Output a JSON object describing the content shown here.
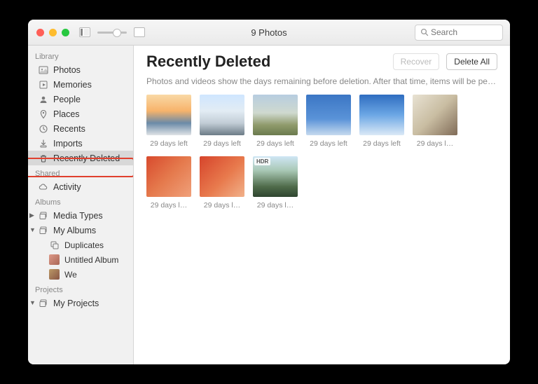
{
  "window_title": "9 Photos",
  "search_placeholder": "Search",
  "sidebar": {
    "sections": [
      {
        "label": "Library",
        "items": [
          {
            "id": "photos",
            "label": "Photos"
          },
          {
            "id": "memories",
            "label": "Memories"
          },
          {
            "id": "people",
            "label": "People"
          },
          {
            "id": "places",
            "label": "Places"
          },
          {
            "id": "recents",
            "label": "Recents"
          },
          {
            "id": "imports",
            "label": "Imports"
          },
          {
            "id": "recently-deleted",
            "label": "Recently Deleted",
            "selected": true
          }
        ]
      },
      {
        "label": "Shared",
        "items": [
          {
            "id": "activity",
            "label": "Activity"
          }
        ]
      },
      {
        "label": "Albums",
        "items": [
          {
            "id": "media-types",
            "label": "Media Types",
            "disclosure": "closed"
          },
          {
            "id": "my-albums",
            "label": "My Albums",
            "disclosure": "open",
            "children": [
              {
                "id": "duplicates",
                "label": "Duplicates"
              },
              {
                "id": "untitled",
                "label": "Untitled Album"
              },
              {
                "id": "we",
                "label": "We"
              }
            ]
          }
        ]
      },
      {
        "label": "Projects",
        "items": [
          {
            "id": "my-projects",
            "label": "My Projects",
            "disclosure": "open"
          }
        ]
      }
    ]
  },
  "header": {
    "title": "Recently Deleted",
    "recover_label": "Recover",
    "delete_all_label": "Delete All",
    "description": "Photos and videos show the days remaining before deletion. After that time, items will be permanently deleted. This may…"
  },
  "hdr_label": "HDR",
  "photos": [
    {
      "caption": "29 days left",
      "thumb": "t0"
    },
    {
      "caption": "29 days left",
      "thumb": "t1"
    },
    {
      "caption": "29 days left",
      "thumb": "t2"
    },
    {
      "caption": "29 days left",
      "thumb": "t3"
    },
    {
      "caption": "29 days left",
      "thumb": "t4"
    },
    {
      "caption": "29 days l…",
      "thumb": "t5"
    },
    {
      "caption": "29 days l…",
      "thumb": "t6"
    },
    {
      "caption": "29 days l…",
      "thumb": "t7"
    },
    {
      "caption": "29 days l…",
      "thumb": "t8",
      "hdr": true
    }
  ]
}
